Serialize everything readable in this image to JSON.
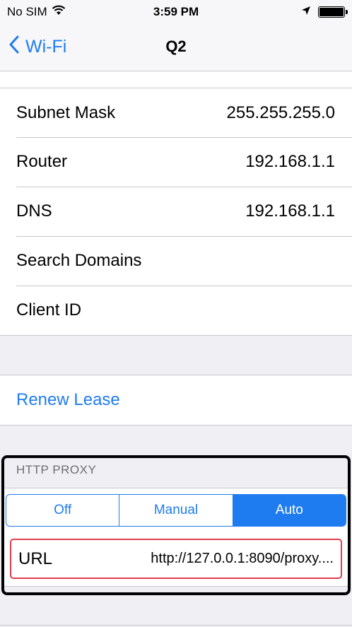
{
  "status_bar": {
    "carrier": "No SIM",
    "time": "3:59 PM"
  },
  "nav": {
    "back_label": "Wi-Fi",
    "title": "Q2"
  },
  "network_info": [
    {
      "label": "Subnet Mask",
      "value": "255.255.255.0"
    },
    {
      "label": "Router",
      "value": "192.168.1.1"
    },
    {
      "label": "DNS",
      "value": "192.168.1.1"
    },
    {
      "label": "Search Domains",
      "value": ""
    },
    {
      "label": "Client ID",
      "value": ""
    }
  ],
  "renew_lease_label": "Renew Lease",
  "http_proxy": {
    "header": "HTTP PROXY",
    "options": [
      "Off",
      "Manual",
      "Auto"
    ],
    "selected": "Auto",
    "url_label": "URL",
    "url_value": "http://127.0.0.1:8090/proxy...."
  },
  "colors": {
    "accent": "#1f7cf0",
    "highlight_border": "#e03c4b"
  }
}
